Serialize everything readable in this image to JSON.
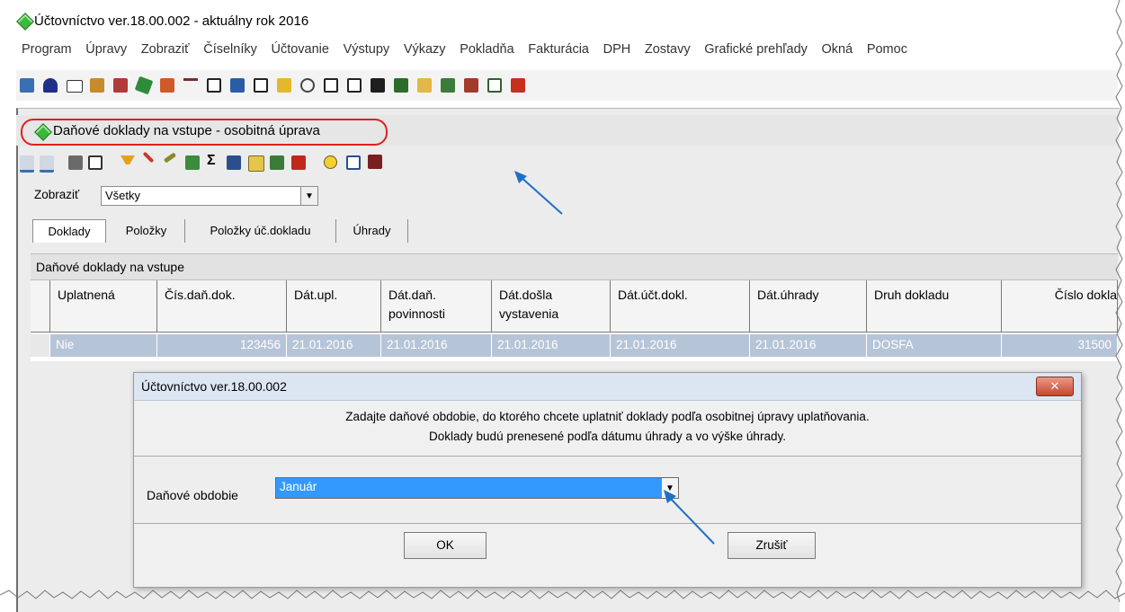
{
  "app": {
    "title": "Účtovníctvo ver.18.00.002  - aktuálny rok 2016",
    "menu": [
      "Program",
      "Úpravy",
      "Zobraziť",
      "Číselníky",
      "Účtovanie",
      "Výstupy",
      "Výkazy",
      "Pokladňa",
      "Fakturácia",
      "DPH",
      "Zostavy",
      "Grafické prehľady",
      "Okná",
      "Pomoc"
    ]
  },
  "window": {
    "title": "Daňové doklady na vstupe - osobitná úprava",
    "filter_label": "Zobraziť",
    "filter_value": "Všetky",
    "tabs": [
      "Doklady",
      "Položky",
      "Položky úč.dokladu",
      "Úhrady"
    ],
    "grid_caption": "Daňové doklady na vstupe",
    "columns": [
      "Uplatnená",
      "Čís.daň.dok.",
      "Dát.upl.",
      "Dát.daň. povinnosti",
      "Dát.došla vystavenia",
      "Dát.účt.dokl.",
      "Dát.úhrady",
      "Druh dokladu",
      "Číslo dokla"
    ],
    "rows": [
      [
        "Nie",
        "123456",
        "21.01.2016",
        "21.01.2016",
        "21.01.2016",
        "21.01.2016",
        "21.01.2016",
        "DOSFA",
        "31500"
      ]
    ]
  },
  "dialog": {
    "title": "Účtovníctvo ver.18.00.002",
    "message_line1": "Zadajte daňové obdobie, do ktorého chcete uplatniť doklady podľa osobitnej úpravy uplatňovania.",
    "message_line2": "Doklady budú prenesené podľa dátumu úhrady a vo výške úhrady.",
    "period_label": "Daňové obdobie",
    "period_value": "Január",
    "ok_label": "OK",
    "cancel_label": "Zrušiť",
    "close_glyph": "✕"
  },
  "icons": {
    "main_toolbar": [
      "book-icon",
      "lock-icon",
      "mail-icon",
      "building-icon",
      "report-icon",
      "pencil-icon",
      "tools-icon",
      "antenna-icon",
      "columns-icon",
      "chart-icon",
      "table-icon",
      "picture-icon",
      "link-icon",
      "grid-icon",
      "list-icon",
      "window-icon",
      "calculator-icon",
      "folder-key-icon",
      "bars-icon",
      "bars2-icon",
      "edit-icon",
      "cascade-icon"
    ],
    "window_toolbar": [
      "prev-icon",
      "next-icon",
      "print-icon",
      "preview-icon",
      "filter-icon",
      "filter-off-icon",
      "pick-icon",
      "copy-icon",
      "sum-icon",
      "export-icon",
      "calendar-icon",
      "columns-icon",
      "windows-icon",
      "info-icon",
      "apply-icon",
      "delete-icon"
    ]
  },
  "colors": {
    "annotation_red": "#e02020",
    "annotation_arrow": "#1e6fc8",
    "selected_row": "#b6c4d8",
    "dropdown_selected": "#3399ff"
  }
}
